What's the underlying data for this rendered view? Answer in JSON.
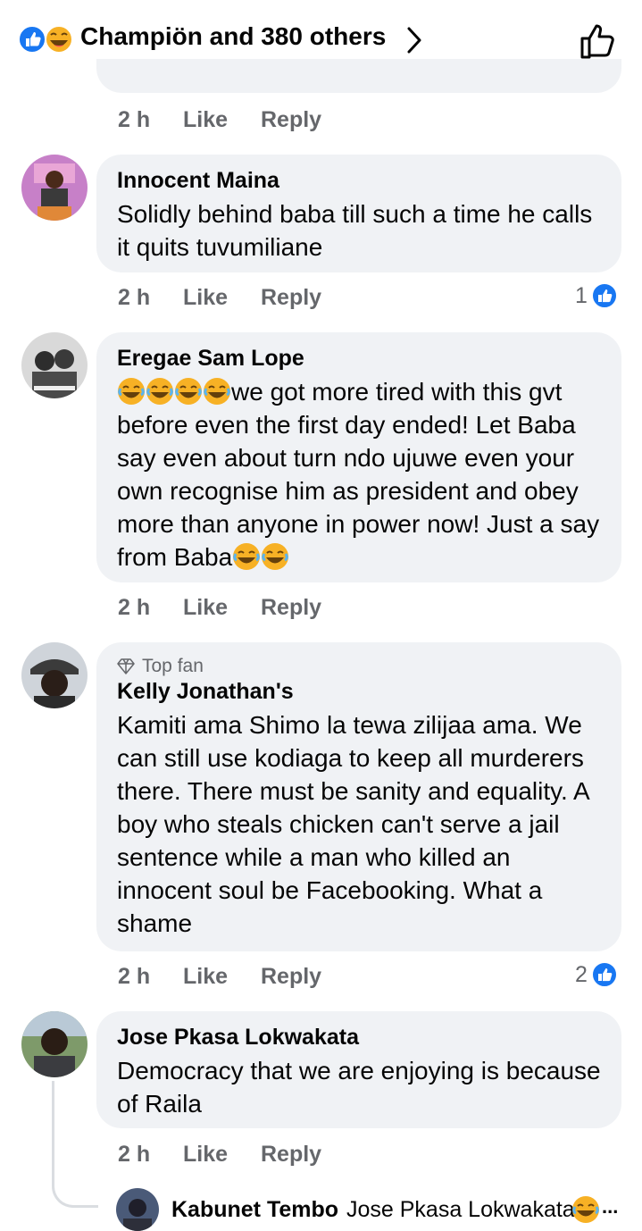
{
  "header": {
    "title": "Champiön and 380 others"
  },
  "colors": {
    "facebook_blue": "#1877f2",
    "haha_yellow": "#f7b125",
    "bubble": "#f0f2f5",
    "meta_gray": "#65676b"
  },
  "prev_comment": {
    "time": "2 h",
    "like": "Like",
    "reply": "Reply"
  },
  "comments": [
    {
      "name": "Innocent Maina",
      "text": "Solidly behind baba till such a time he calls it quits tuvumiliane",
      "time": "2 h",
      "like": "Like",
      "reply": "Reply",
      "likes": "1"
    },
    {
      "name": "Eregae Sam Lope",
      "text_main": "we got more tired with this gvt before even the first day ended! Let Baba say even about turn ndo ujuwe even your own recognise him as president and obey more than anyone in power now! Just a say from Baba",
      "time": "2 h",
      "like": "Like",
      "reply": "Reply"
    },
    {
      "badge": "Top fan",
      "name": "Kelly Jonathan's",
      "text": "Kamiti ama Shimo la tewa zilijaa ama. We can still use kodiaga to keep all murderers there. There must be sanity and equality. A boy who steals chicken can't serve a jail sentence while a man who killed an innocent soul be Facebooking. What a shame",
      "time": "2 h",
      "like": "Like",
      "reply": "Reply",
      "likes": "2"
    },
    {
      "name": "Jose Pkasa Lokwakata",
      "text": "Democracy that we are enjoying is because of Raila",
      "time": "2 h",
      "like": "Like",
      "reply": "Reply"
    }
  ],
  "reply_preview": {
    "name": "Kabunet Tembo",
    "text": "Jose Pkasa Lokwakata",
    "ellipsis": "..."
  }
}
